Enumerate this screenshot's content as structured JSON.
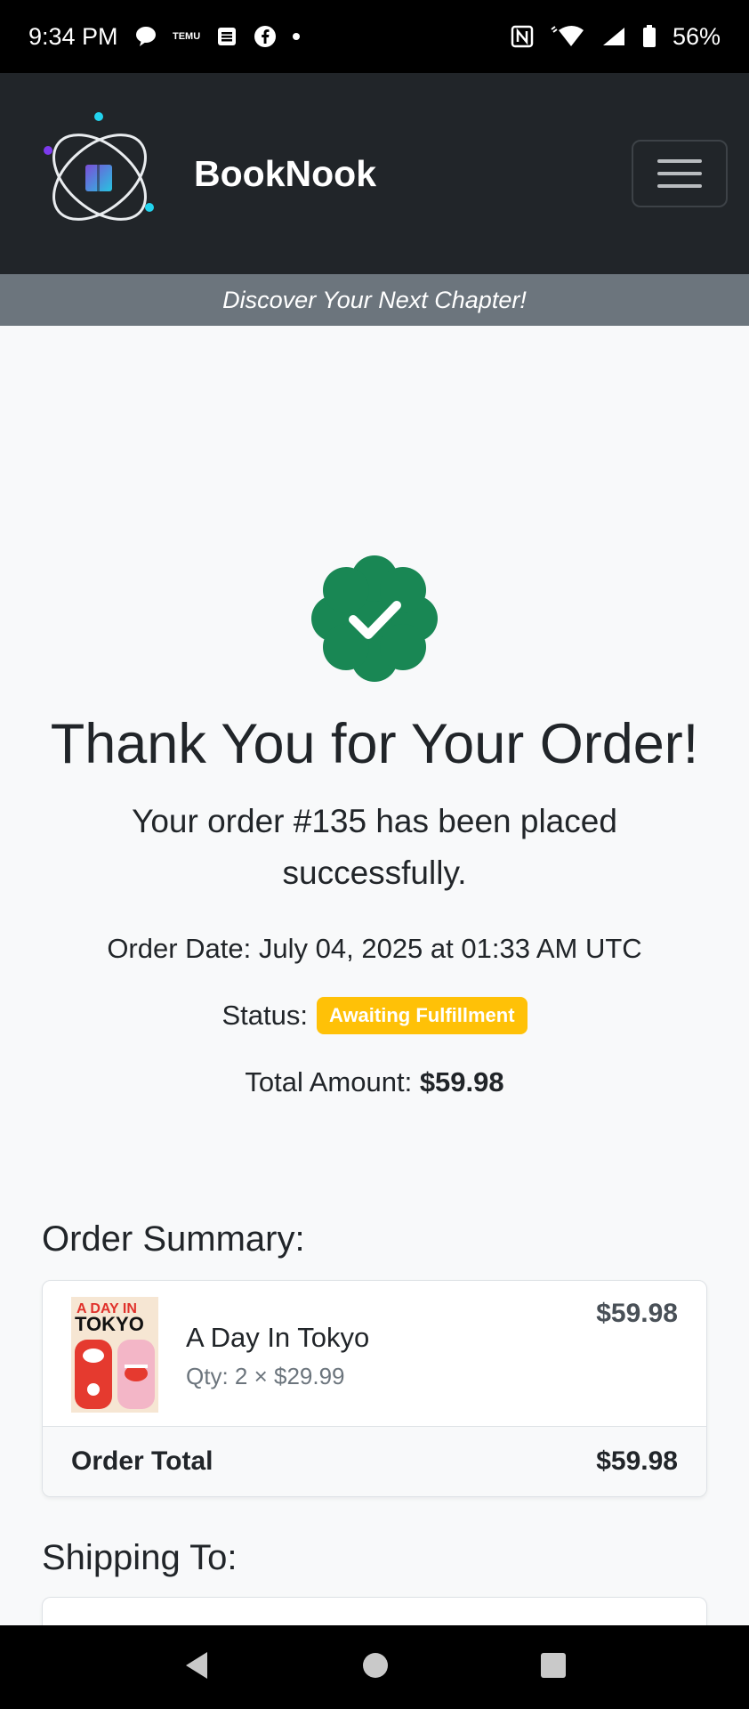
{
  "status_bar": {
    "time": "9:34 PM",
    "temu_label": "TEMU",
    "battery": "56%",
    "icons": [
      "chat-bubble-icon",
      "temu-icon",
      "app-icon",
      "facebook-icon",
      "nfc-icon",
      "wifi-icon",
      "signal-icon",
      "battery-icon"
    ]
  },
  "navbar": {
    "brand": "BookNook",
    "menu_icon": "hamburger-icon"
  },
  "tagline": "Discover Your Next Chapter!",
  "confirmation": {
    "title": "Thank You for Your Order!",
    "lead_prefix": "Your order",
    "order_number": "#135",
    "lead_suffix": "has been placed successfully.",
    "order_date_label": "Order Date:",
    "order_date": "July 04, 2025 at 01:33 AM UTC",
    "status_label": "Status:",
    "status": "Awaiting Fulfillment",
    "total_label": "Total Amount:",
    "total": "$59.98"
  },
  "summary": {
    "title": "Order Summary:",
    "items": [
      {
        "name": "A Day In Tokyo",
        "qty": "Qty: 2 × $29.99",
        "price": "$59.98",
        "cover_text_1": "A DAY IN",
        "cover_text_2": "TOKYO"
      }
    ],
    "total_label": "Order Total",
    "total": "$59.98"
  },
  "shipping": {
    "title": "Shipping To:"
  },
  "colors": {
    "navbar": "#212529",
    "tagline_bg": "#6c757d",
    "success": "#198754",
    "badge": "#ffc107"
  }
}
